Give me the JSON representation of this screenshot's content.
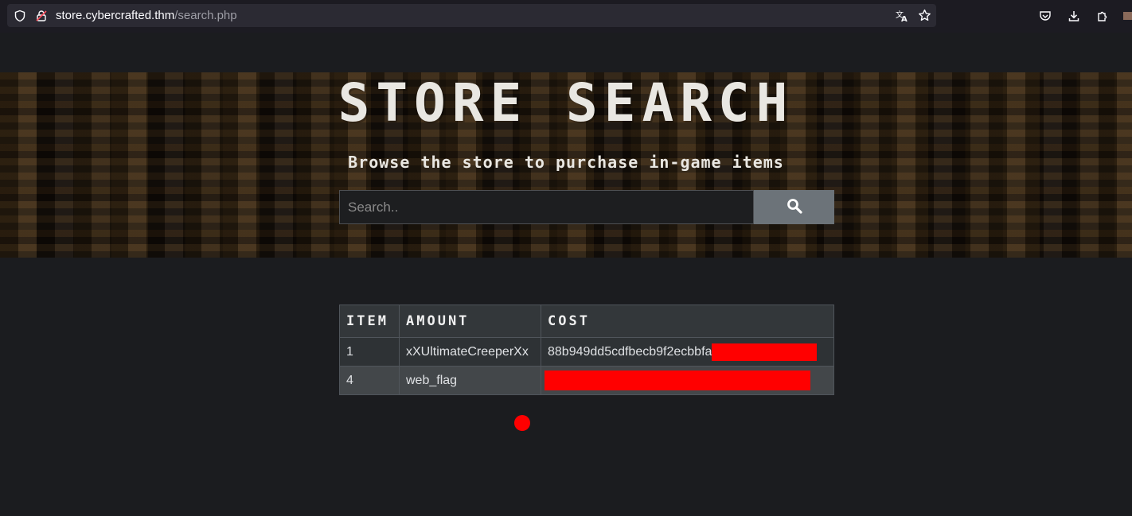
{
  "browser": {
    "url_host": "store.cybercrafted.thm",
    "url_path": "/search.php"
  },
  "hero": {
    "title": "STORE SEARCH",
    "subtitle": "Browse the store to purchase in-game items",
    "search_placeholder": "Search.."
  },
  "table": {
    "headers": [
      "ITEM",
      "AMOUNT",
      "COST"
    ],
    "rows": [
      {
        "item": "1",
        "amount": "xXUltimateCreeperXx",
        "cost": "88b949dd5cdfbecb9f2ecbbfa"
      },
      {
        "item": "4",
        "amount": "web_flag",
        "cost": ""
      }
    ]
  },
  "colors": {
    "redaction": "#ff0000",
    "page_bg": "#1b1c1f",
    "table_header_bg": "#33373a"
  }
}
